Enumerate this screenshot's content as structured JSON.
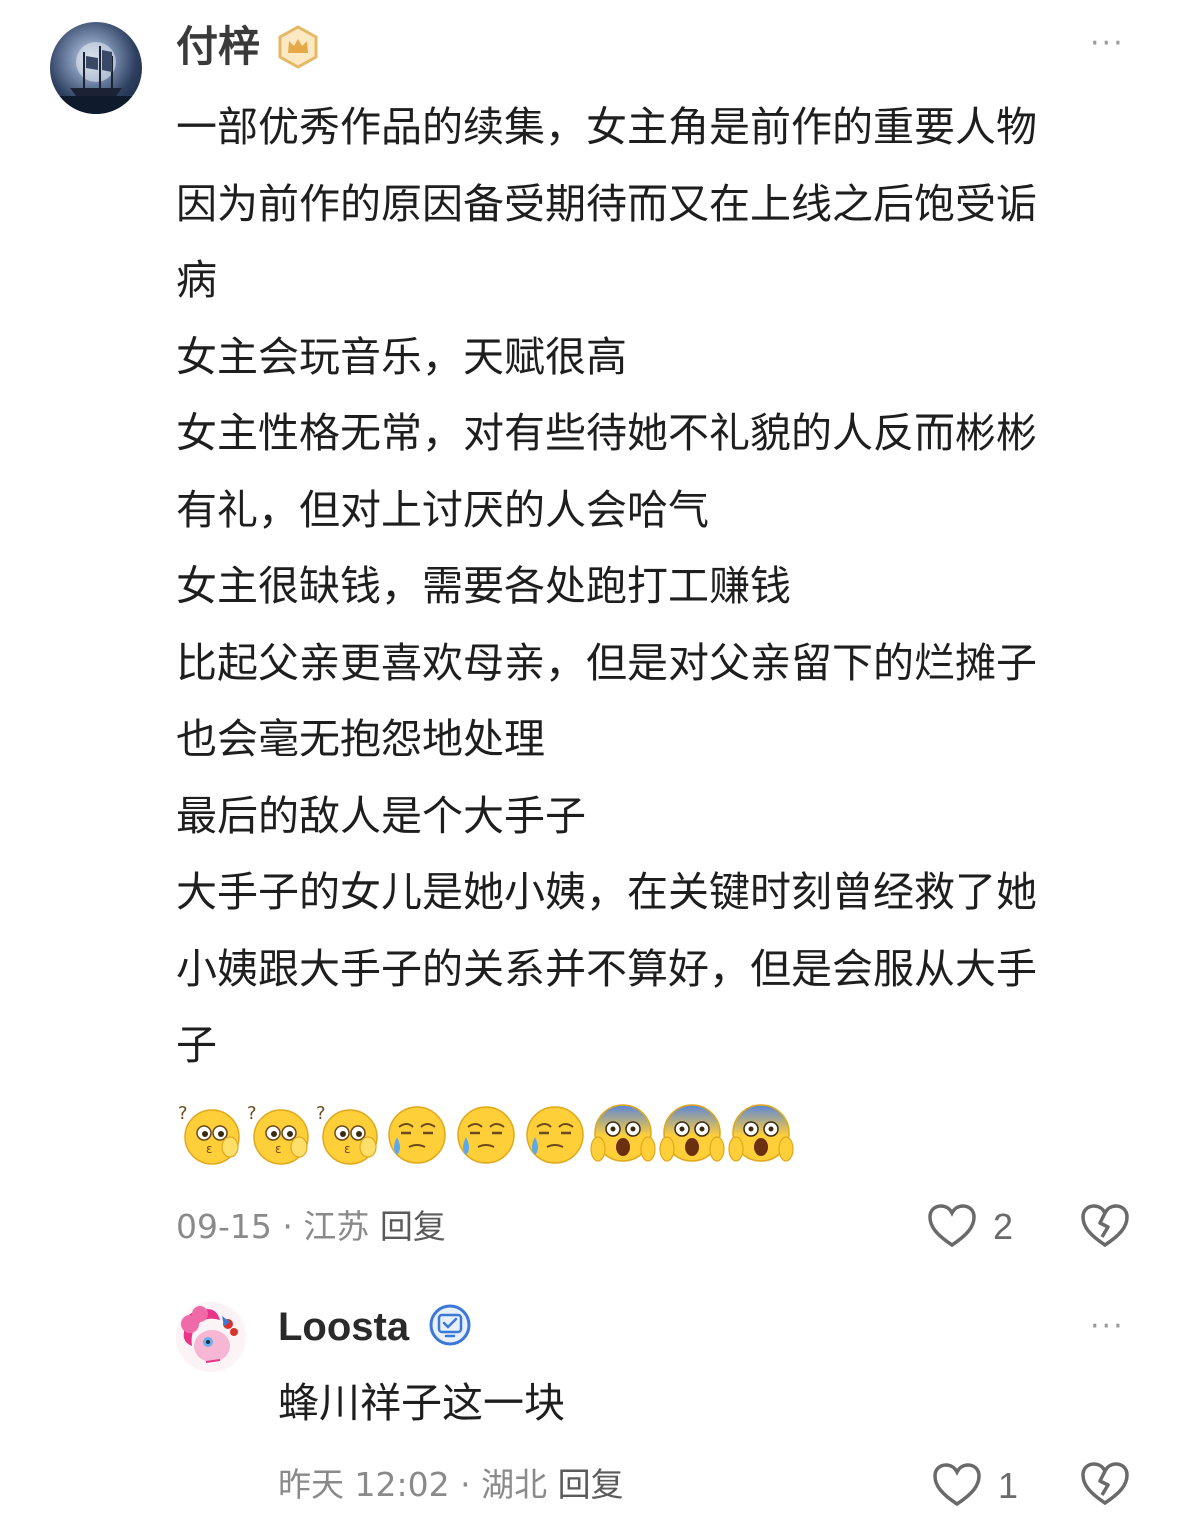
{
  "comments": [
    {
      "username": "付梓",
      "badge_icon": "crown-badge-icon",
      "lines": [
        "一部优秀作品的续集，女主角是前作的重要人物",
        "因为前作的原因备受期待而又在上线之后饱受诟",
        "病",
        "女主会玩音乐，天赋很高",
        "女主性格无常，对有些待她不礼貌的人反而彬彬",
        "有礼，但对上讨厌的人会哈气",
        "女主很缺钱，需要各处跑打工赚钱",
        "比起父亲更喜欢母亲，但是对父亲留下的烂摊子",
        "也会毫无抱怨地处理",
        "最后的敌人是个大手子",
        "大手子的女儿是她小姨，在关键时刻曾经救了她",
        "小姨跟大手子的关系并不算好，但是会服从大手",
        "子"
      ],
      "emojis": [
        "confused-emoji",
        "confused-emoji",
        "confused-emoji",
        "crying-emoji",
        "crying-emoji",
        "crying-emoji",
        "screaming-emoji",
        "screaming-emoji",
        "screaming-emoji"
      ],
      "date": "09-15",
      "separator": "·",
      "location": "江苏",
      "reply_label": "回复",
      "like_count": "2"
    },
    {
      "username": "Loosta",
      "badge_icon": "verified-badge-icon",
      "lines": [
        "蜂川祥子这一块"
      ],
      "date": "昨天 12:02",
      "separator": "·",
      "location": "湖北",
      "reply_label": "回复",
      "like_count": "1"
    }
  ],
  "more_label": "···",
  "colors": {
    "badge_gold": "#e6b866",
    "badge_blue": "#3b78d8",
    "meta_gray": "#8a8a8a",
    "emoji_yellow": "#ffcf3a"
  }
}
